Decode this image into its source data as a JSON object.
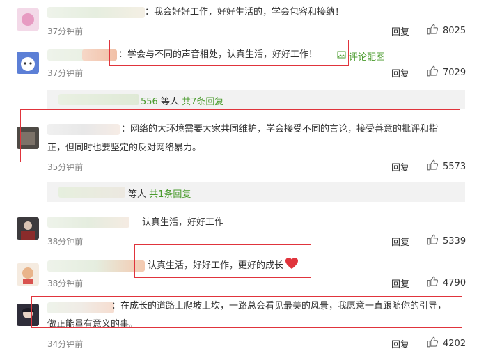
{
  "comments": [
    {
      "text": "：我会好好工作，好好生活的，学会包容和接纳！",
      "time": "37分钟前",
      "reply": "回复",
      "likes": "8025"
    },
    {
      "text": "：学会与不同的声音相处，认真生活，好好工作！",
      "image_link": "评论配图",
      "time": "37分钟前",
      "reply": "回复",
      "likes": "7029"
    },
    {
      "text_line1": "：网络的大环境需要大家共同维护，学会接受不同的言论，接受善意的批评和指",
      "text_line2": "正，但同时也要坚定的反对网络暴力。",
      "time": "35分钟前",
      "reply": "回复",
      "likes": "5573"
    },
    {
      "text": "认真生活，好好工作",
      "time": "38分钟前",
      "reply": "回复",
      "likes": "5339"
    },
    {
      "text": "认真生活，好好工作，更好的成长",
      "time": "38分钟前",
      "reply": "回复",
      "likes": "4790"
    },
    {
      "text_line1": "：在成长的道路上爬坡上坎，一路总会看见最美的风景，我愿意一直跟随你的引导，",
      "text_line2": "做正能量有意义的事。",
      "time": "34分钟前",
      "reply": "回复",
      "likes": "4202"
    }
  ],
  "subreplies": [
    {
      "users_suffix": "556",
      "text": "等人",
      "link": "共7条回复"
    },
    {
      "users_suffix": "",
      "text": "等人",
      "link": "共1条回复"
    }
  ],
  "colors": {
    "link": "#4a9b2d",
    "highlight_box": "#e0343c",
    "heart": "#e0343c"
  }
}
